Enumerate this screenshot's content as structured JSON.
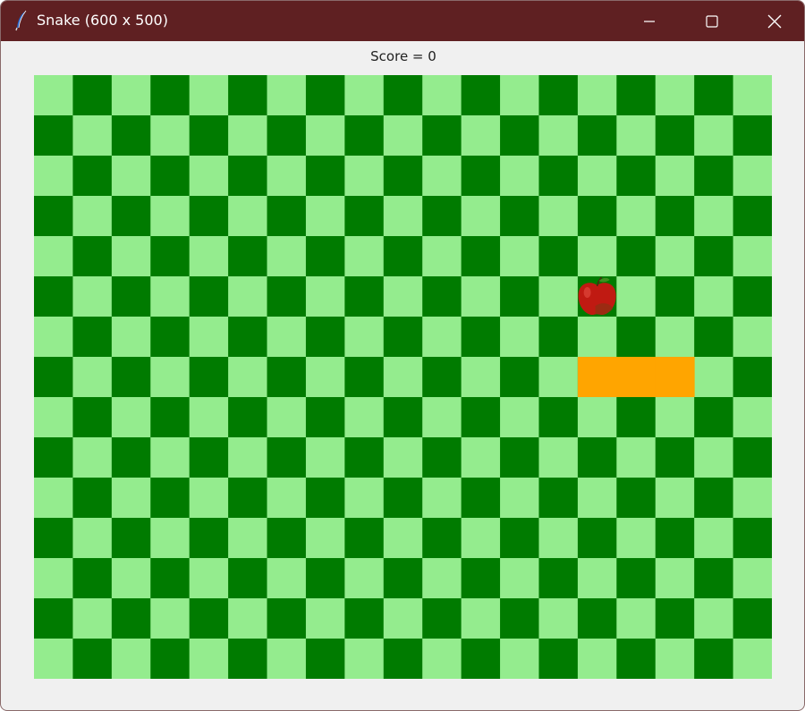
{
  "window": {
    "title": "Snake (600 x 500)",
    "icon": "feather-icon",
    "controls": [
      "minimize-icon",
      "maximize-icon",
      "close-icon"
    ]
  },
  "game": {
    "score_text": "Score = 0",
    "grid": {
      "cols": 19,
      "rows": 15
    },
    "colors": {
      "light_cell": "#94ec8e",
      "dark_cell": "#007b00",
      "snake": "#ffa500",
      "apple": "#c01a12",
      "titlebar": "#5f2022"
    },
    "snake": [
      {
        "col": 14,
        "row": 7
      },
      {
        "col": 15,
        "row": 7
      },
      {
        "col": 16,
        "row": 7
      }
    ],
    "apple": {
      "col": 14,
      "row": 5,
      "icon": "apple-icon"
    }
  }
}
